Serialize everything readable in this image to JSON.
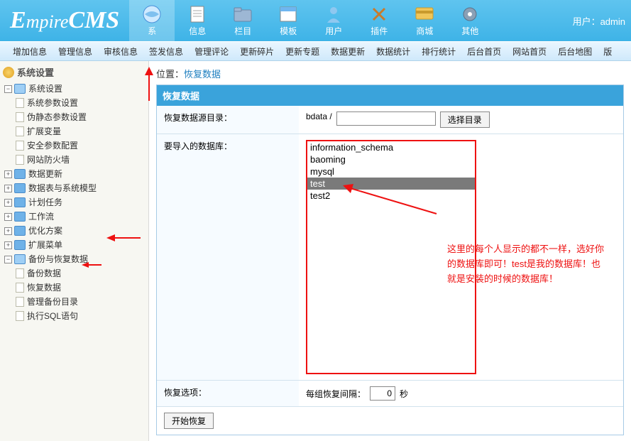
{
  "app": {
    "logo_prefix": "E",
    "logo_rest": "mpire",
    "logo_suffix": "CMS"
  },
  "user": {
    "label": "用户：",
    "name": "admin"
  },
  "nav": [
    {
      "label": "系",
      "active": true
    },
    {
      "label": "信息"
    },
    {
      "label": "栏目"
    },
    {
      "label": "模板"
    },
    {
      "label": "用户"
    },
    {
      "label": "插件"
    },
    {
      "label": "商城"
    },
    {
      "label": "其他"
    }
  ],
  "subnav": [
    "增加信息",
    "管理信息",
    "审核信息",
    "签发信息",
    "管理评论",
    "更新碎片",
    "更新专题",
    "数据更新",
    "数据统计",
    "排行统计",
    "后台首页",
    "网站首页",
    "后台地图",
    "版"
  ],
  "sidebar": {
    "title": "系统设置",
    "groups": [
      {
        "label": "系统设置",
        "open": true,
        "children": [
          {
            "label": "系统参数设置"
          },
          {
            "label": "伪静态参数设置"
          },
          {
            "label": "扩展变量"
          },
          {
            "label": "安全参数配置"
          },
          {
            "label": "网站防火墙"
          }
        ]
      },
      {
        "label": "数据更新",
        "open": false
      },
      {
        "label": "数据表与系统模型",
        "open": false
      },
      {
        "label": "计划任务",
        "open": false
      },
      {
        "label": "工作流",
        "open": false
      },
      {
        "label": "优化方案",
        "open": false
      },
      {
        "label": "扩展菜单",
        "open": false
      },
      {
        "label": "备份与恢复数据",
        "open": true,
        "children": [
          {
            "label": "备份数据"
          },
          {
            "label": "恢复数据",
            "hot": true
          },
          {
            "label": "管理备份目录"
          },
          {
            "label": "执行SQL语句"
          }
        ]
      }
    ]
  },
  "breadcrumb": {
    "loc": "位置：",
    "page": "恢复数据"
  },
  "panel": {
    "title": "恢复数据",
    "src_label": "恢复数据源目录：",
    "src_prefix": "bdata /",
    "src_value": "",
    "browse_btn": "选择目录",
    "db_label": "要导入的数据库：",
    "databases": [
      {
        "name": "information_schema"
      },
      {
        "name": "baoming"
      },
      {
        "name": "mysql"
      },
      {
        "name": "test",
        "selected": true
      },
      {
        "name": "test2"
      }
    ],
    "opt_label": "恢复选项：",
    "interval_label": "每组恢复间隔：",
    "interval_value": "0",
    "interval_unit": "秒",
    "submit": "开始恢复"
  },
  "annotation": {
    "line1": "这里的每个人显示的都不一样，选好你",
    "line2": "的数据库即可！test是我的数据库！也",
    "line3": "就是安装的时候的数据库！"
  }
}
